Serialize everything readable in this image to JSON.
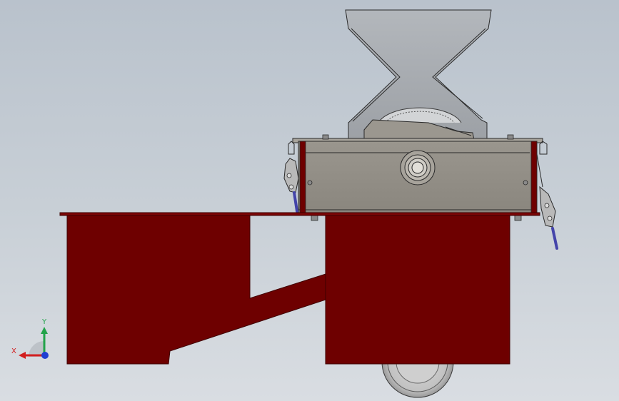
{
  "view": {
    "background_top": "#b9c2cc",
    "background_bottom": "#d9dde2"
  },
  "colors": {
    "frame": "#6e0000",
    "frame_edge": "#3d0000",
    "housing": "#8f8b83",
    "hopper": "#a3a7ac",
    "outline": "#2a2a2a",
    "handle": "#4444aa"
  },
  "triad": {
    "x_label": "X",
    "y_label": "Y",
    "x_color": "#d21f1f",
    "y_color": "#22a34a",
    "z_color": "#1f3fd2"
  }
}
